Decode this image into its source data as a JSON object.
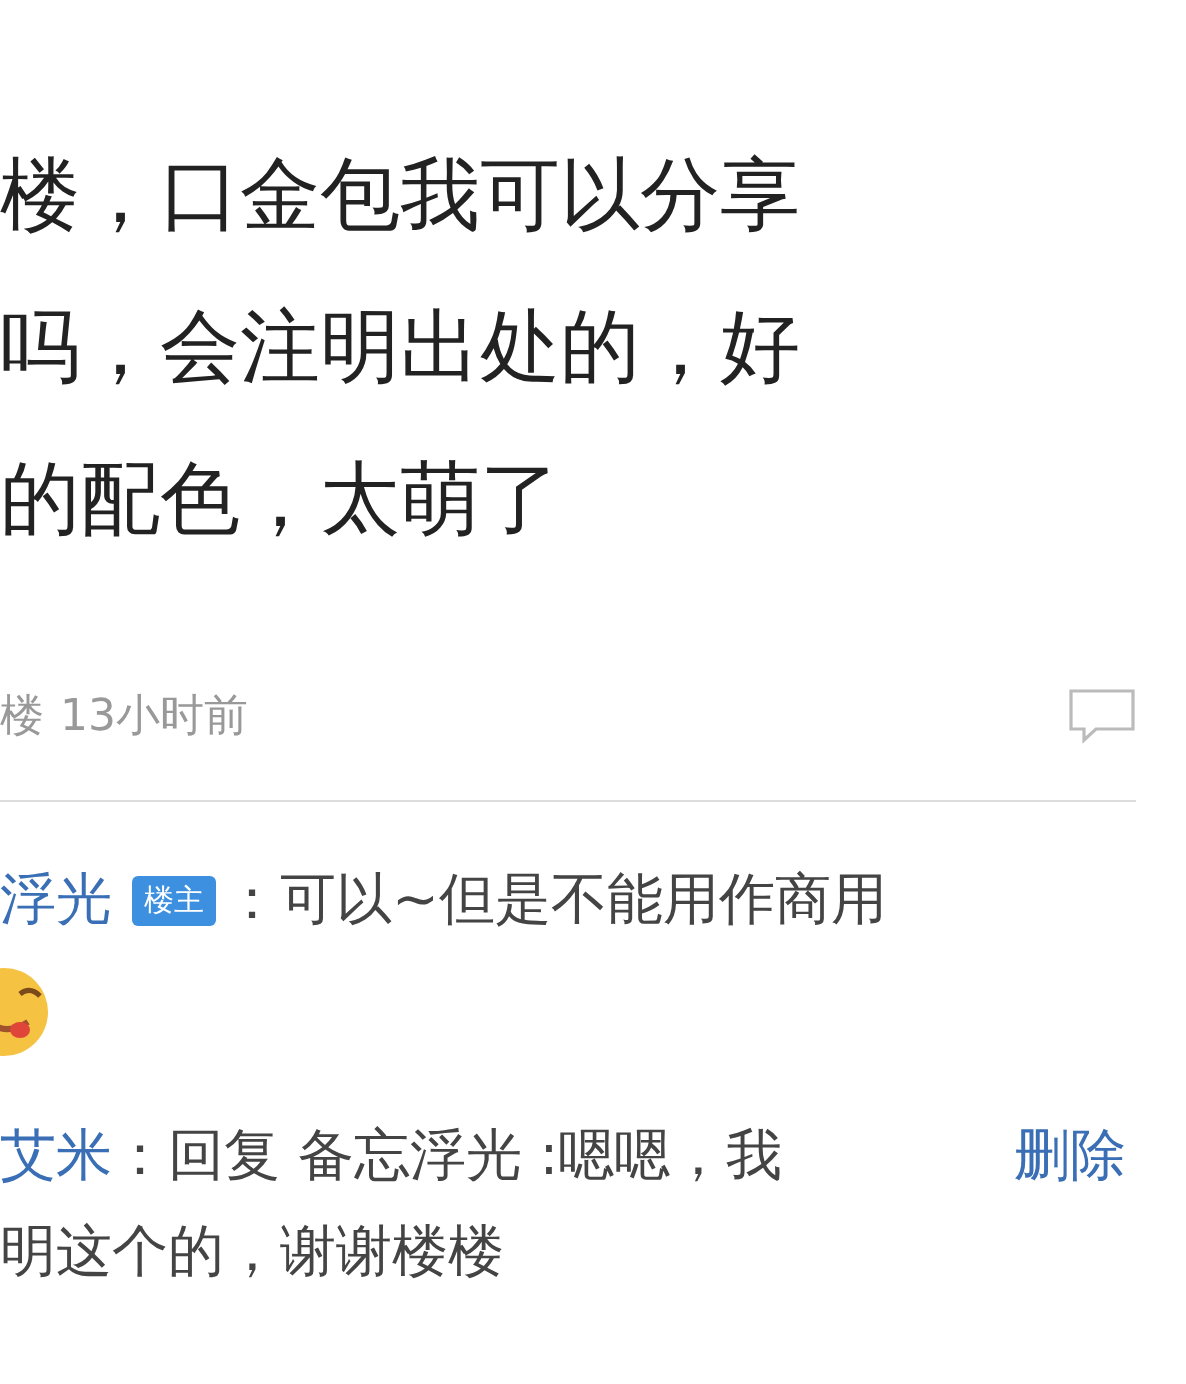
{
  "post": {
    "lines": [
      "楼，口金包我可以分享",
      "吗，会注明出处的，好",
      "的配色，太萌了"
    ],
    "floor": "楼",
    "time": "13小时前"
  },
  "replies": [
    {
      "author": "浮光",
      "badge": "楼主",
      "text": "：可以~但是不能用作商用",
      "has_emoji": true
    },
    {
      "author": "艾米",
      "text": "：回复 备忘浮光 :嗯嗯，我",
      "action": "删除",
      "continuation": "明这个的，谢谢楼楼"
    }
  ]
}
